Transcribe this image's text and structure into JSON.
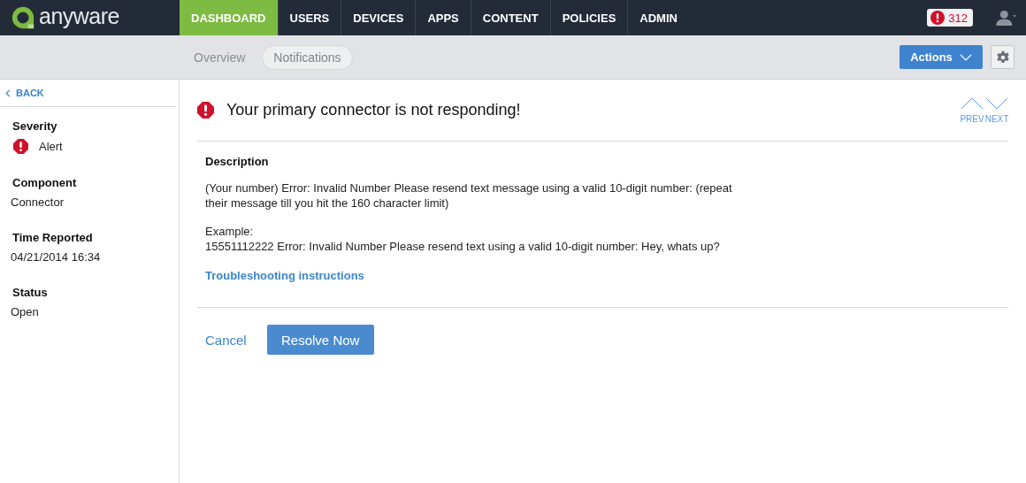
{
  "brand": {
    "name": "anyware"
  },
  "nav": [
    {
      "label": "DASHBOARD",
      "selected": true
    },
    {
      "label": "USERS",
      "selected": false
    },
    {
      "label": "DEVICES",
      "selected": false
    },
    {
      "label": "APPS",
      "selected": false
    },
    {
      "label": "CONTENT",
      "selected": false
    },
    {
      "label": "POLICIES",
      "selected": false
    },
    {
      "label": "ADMIN",
      "selected": false
    }
  ],
  "alerts_badge": {
    "count": "312"
  },
  "subnav": [
    {
      "label": "Overview",
      "selected": false
    },
    {
      "label": "Notifications",
      "selected": true
    }
  ],
  "actions_button": {
    "label": "Actions"
  },
  "back_link": {
    "label": "BACK"
  },
  "details": [
    {
      "kind": "severity",
      "label": "Severity",
      "value": "Alert"
    },
    {
      "kind": "text",
      "label": "Component",
      "value": "Connector"
    },
    {
      "kind": "text",
      "label": "Time Reported",
      "value": "04/21/2014 16:34"
    },
    {
      "kind": "text",
      "label": "Status",
      "value": "Open"
    }
  ],
  "notification": {
    "title": "Your primary connector is not responding!",
    "prev": "PREV",
    "next": "NEXT"
  },
  "description": {
    "heading": "Description",
    "paragraphs": [
      "(Your number) Error: Invalid Number Please resend text message using a valid 10-digit number: (repeat their message till you hit the 160 character limit)",
      "Example:\n15551112222 Error: Invalid Number Please resend text using a valid 10-digit number: Hey, whats up?"
    ],
    "link": "Troubleshooting instructions"
  },
  "buttons": {
    "cancel": "Cancel",
    "resolve": "Resolve Now"
  }
}
